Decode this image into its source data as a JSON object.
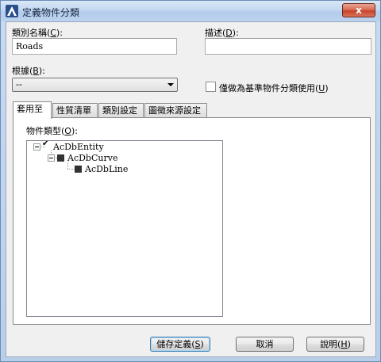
{
  "window": {
    "title": "定義物件分類",
    "close_label": "x"
  },
  "class_name": {
    "label": "類別名稱(",
    "hotkey": "C",
    "label_end": "):",
    "value": "Roads"
  },
  "description": {
    "label": "描述(",
    "hotkey": "D",
    "label_end": "):",
    "value": ""
  },
  "base_on": {
    "label": "根據(",
    "hotkey": "B",
    "label_end": "):",
    "selected": "--"
  },
  "classify_only": {
    "label": "僅做為基準物件分類使用(",
    "hotkey": "U",
    "label_end": ")",
    "checked": false
  },
  "tabs": [
    {
      "label": "套用至",
      "active": true
    },
    {
      "label": "性質清單",
      "active": false
    },
    {
      "label": "類別設定",
      "active": false
    },
    {
      "label": "圖徵來源設定",
      "active": false
    }
  ],
  "object_types": {
    "label": "物件類型(",
    "hotkey": "O",
    "label_end": "):",
    "tree": [
      {
        "label": "AcDbEntity",
        "state": "checked"
      },
      {
        "label": "AcDbCurve",
        "state": "partial"
      },
      {
        "label": "AcDbLine",
        "state": "partial"
      }
    ]
  },
  "buttons": {
    "save_label": "儲存定義(",
    "save_hotkey": "S",
    "save_end": ")",
    "cancel_label": "取消",
    "help_label": "說明(",
    "help_hotkey": "H",
    "help_end": ")"
  },
  "colors": {
    "title_bg": "#c3d8f1",
    "close_bg": "#c7432a",
    "dialog_bg": "#f0f0f0"
  }
}
